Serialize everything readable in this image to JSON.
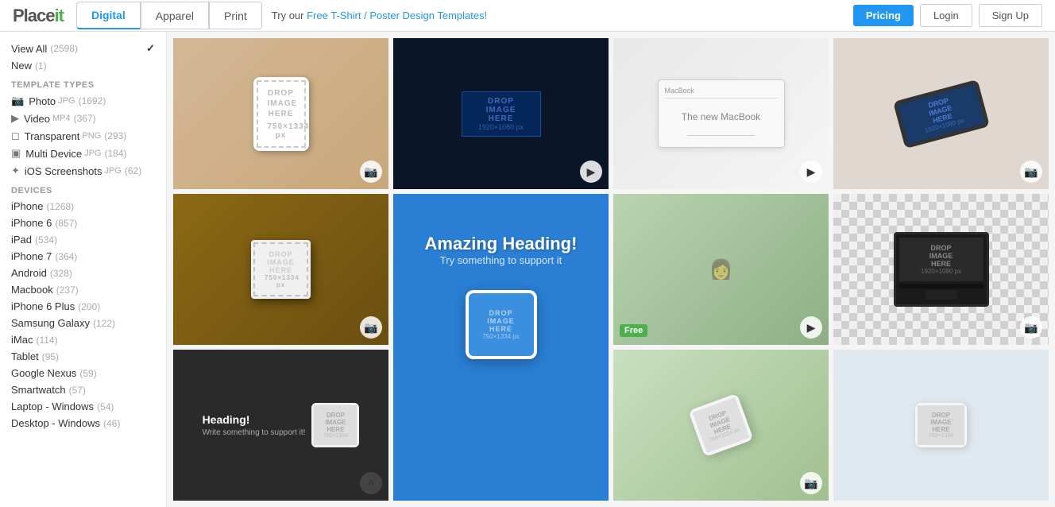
{
  "header": {
    "logo": "Placeit",
    "logo_accent": "it",
    "nav": {
      "tabs": [
        {
          "id": "digital",
          "label": "Digital",
          "active": true
        },
        {
          "id": "apparel",
          "label": "Apparel",
          "active": false
        },
        {
          "id": "print",
          "label": "Print",
          "active": false
        }
      ]
    },
    "promo_text": "Try our ",
    "promo_link_text": "Free T-Shirt / Poster Design Templates!",
    "pricing_label": "Pricing",
    "login_label": "Login",
    "signup_label": "Sign Up"
  },
  "sidebar": {
    "view_all_label": "View All",
    "view_all_count": "(2598)",
    "new_label": "New",
    "new_count": "(1)",
    "template_types_label": "Template Types",
    "template_types": [
      {
        "icon": "📷",
        "label": "Photo",
        "format": "JPG",
        "count": "(1692)"
      },
      {
        "icon": "▶",
        "label": "Video",
        "format": "MP4",
        "count": "(367)"
      },
      {
        "icon": "◻",
        "label": "Transparent",
        "format": "PNG",
        "count": "(293)"
      },
      {
        "icon": "▣",
        "label": "Multi Device",
        "format": "JPG",
        "count": "(184)"
      },
      {
        "icon": "✦",
        "label": "iOS Screenshots",
        "format": "JPG",
        "count": "(62)"
      }
    ],
    "devices_label": "Devices",
    "devices": [
      {
        "label": "iPhone",
        "count": "(1268)"
      },
      {
        "label": "iPhone 6",
        "count": "(857)"
      },
      {
        "label": "iPad",
        "count": "(534)"
      },
      {
        "label": "iPhone 7",
        "count": "(364)"
      },
      {
        "label": "Android",
        "count": "(328)"
      },
      {
        "label": "Macbook",
        "count": "(237)"
      },
      {
        "label": "iPhone 6 Plus",
        "count": "(200)"
      },
      {
        "label": "Samsung Galaxy",
        "count": "(122)"
      },
      {
        "label": "iMac",
        "count": "(114)"
      },
      {
        "label": "Tablet",
        "count": "(95)"
      },
      {
        "label": "Google Nexus",
        "count": "(59)"
      },
      {
        "label": "Smartwatch",
        "count": "(57)"
      },
      {
        "label": "Laptop - Windows",
        "count": "(54)"
      },
      {
        "label": "Desktop - Windows",
        "count": "(46)"
      }
    ]
  },
  "grid": {
    "items": [
      {
        "id": 1,
        "type": "photo",
        "has_camera": true
      },
      {
        "id": 2,
        "type": "video",
        "has_camera": true
      },
      {
        "id": 3,
        "type": "video",
        "has_camera": true
      },
      {
        "id": 4,
        "type": "photo",
        "has_camera": true
      },
      {
        "id": 5,
        "type": "photo",
        "has_camera": true
      },
      {
        "id": 6,
        "type": "photo+video",
        "has_camera": false,
        "drop_text": "Amazing Heading!",
        "sub_text": "Try something to support it"
      },
      {
        "id": 7,
        "type": "video",
        "has_camera": true,
        "is_free": true
      },
      {
        "id": 8,
        "type": "video",
        "has_camera": true
      },
      {
        "id": 9,
        "type": "photo",
        "has_camera": false,
        "drop_text": "Heading!",
        "sub_text": "Write something to support it!"
      },
      {
        "id": 10,
        "type": "photo",
        "has_camera": false
      },
      {
        "id": 11,
        "type": "photo",
        "has_camera": true
      },
      {
        "id": 12,
        "type": "photo",
        "has_camera": false
      }
    ]
  }
}
